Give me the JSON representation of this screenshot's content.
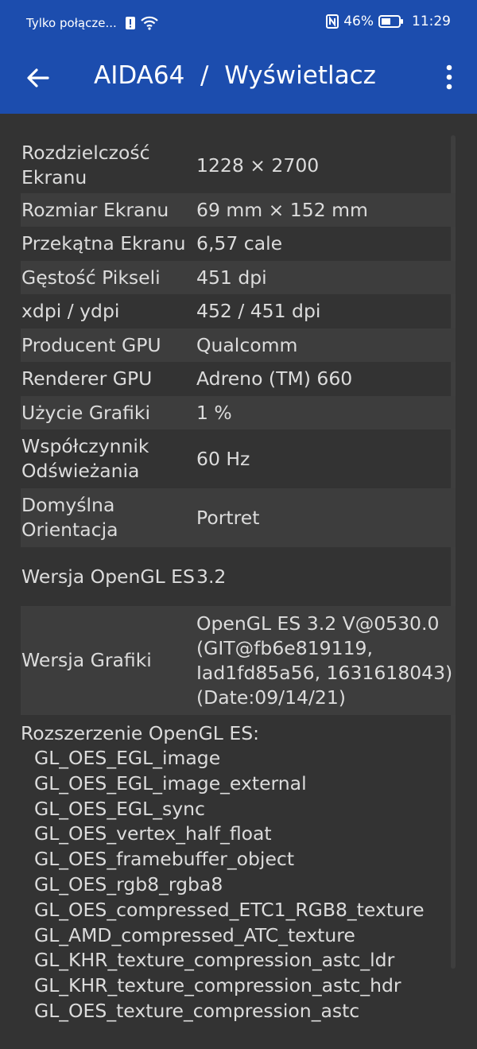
{
  "status_bar": {
    "carrier": "Tylko połącze...",
    "battery": "46%",
    "time": "11:29",
    "icons": [
      "alert-icon",
      "wifi-icon",
      "nfc-icon",
      "battery-icon"
    ]
  },
  "app_bar": {
    "title": "AIDA64  /  Wyświetlacz",
    "back_icon": "arrow-left-icon",
    "menu_icon": "more-vertical-icon",
    "background": "#1c4dae"
  },
  "rows": [
    {
      "label": "Rozdzielczość Ekranu",
      "value": "1228 × 2700"
    },
    {
      "label": "Rozmiar Ekranu",
      "value": "69 mm × 152 mm"
    },
    {
      "label": "Przekątna Ekranu",
      "value": "6,57 cale"
    },
    {
      "label": "Gęstość Pikseli",
      "value": "451 dpi"
    },
    {
      "label": "xdpi / ydpi",
      "value": "452 / 451 dpi"
    },
    {
      "label": "Producent GPU",
      "value": "Qualcomm"
    },
    {
      "label": "Renderer GPU",
      "value": "Adreno (TM) 660"
    },
    {
      "label": "Użycie Grafiki",
      "value": "1 %"
    },
    {
      "label": "Współczynnik Odświeżania",
      "value": "60 Hz"
    },
    {
      "label": "Domyślna Orientacja",
      "value": "Portret"
    },
    {
      "label": "Wersja OpenGL ES",
      "value": "3.2"
    },
    {
      "label": "Wersja Grafiki",
      "value": "OpenGL ES 3.2 V@0530.0\n(GIT@fb6e819119,\nIad1fd85a56, 1631618043)\n(Date:09/14/21)"
    }
  ],
  "extensions": {
    "title": "Rozszerzenie OpenGL ES:",
    "items": [
      "GL_OES_EGL_image",
      "GL_OES_EGL_image_external",
      "GL_OES_EGL_sync",
      "GL_OES_vertex_half_float",
      "GL_OES_framebuffer_object",
      "GL_OES_rgb8_rgba8",
      "GL_OES_compressed_ETC1_RGB8_texture",
      "GL_AMD_compressed_ATC_texture",
      "GL_KHR_texture_compression_astc_ldr",
      "GL_KHR_texture_compression_astc_hdr",
      "GL_OES_texture_compression_astc"
    ]
  }
}
